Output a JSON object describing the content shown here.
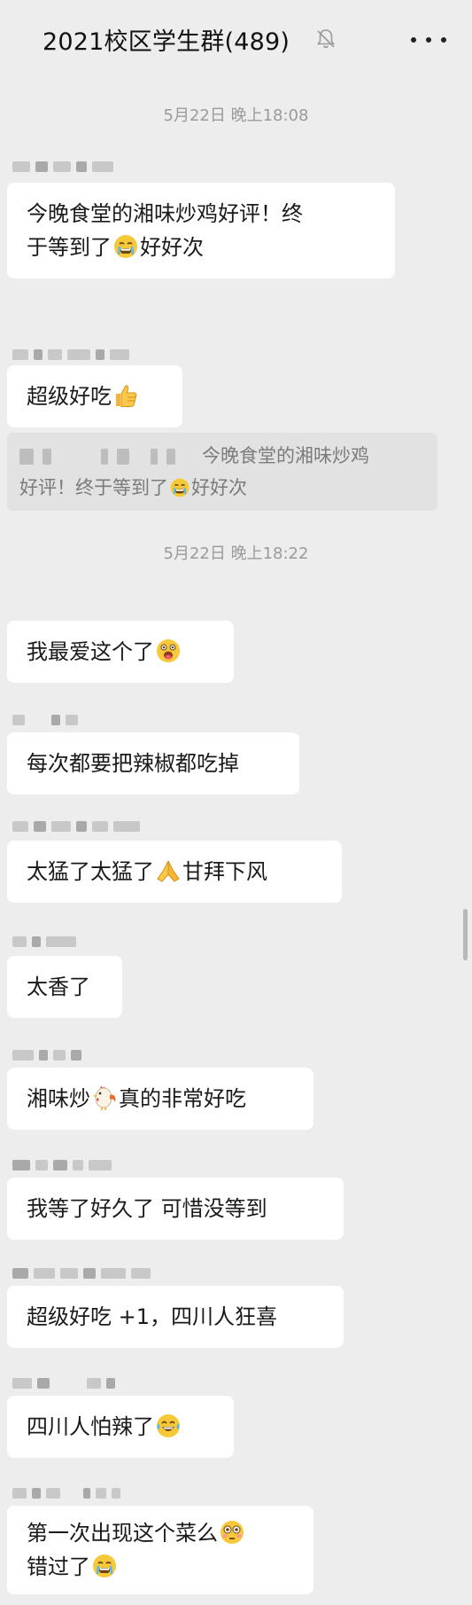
{
  "header": {
    "title": "2021校区学生群(489)",
    "mute_icon": "bell-slash-icon",
    "more_icon": "more-icon"
  },
  "timestamps": [
    "5月22日 晚上18:08",
    "5月22日 晚上18:22"
  ],
  "messages": [
    {
      "line1": "今晚食堂的湘味炒鸡好评！终",
      "line2a": "于等到了",
      "emoji_a": "crying-face-emoji",
      "line2b": "好好次"
    },
    {
      "text": "超级好吃",
      "emoji": "thumbs-up-emoji"
    },
    {
      "text": "我最爱这个了",
      "emoji": "drooling-face-emoji"
    },
    {
      "text": "每次都要把辣椒都吃掉"
    },
    {
      "text_a": "太猛了太猛了",
      "emoji": "praying-hands-emoji",
      "text_b": "甘拜下风"
    },
    {
      "text": "太香了"
    },
    {
      "text_a": "湘味炒",
      "emoji": "rooster-emoji",
      "text_b": "真的非常好吃"
    },
    {
      "text": "我等了好久了 可惜没等到"
    },
    {
      "text": "超级好吃 +1，四川人狂喜"
    },
    {
      "text": "四川人怕辣了",
      "emoji": "tears-of-joy-emoji"
    },
    {
      "line1": "第一次出现这个菜么",
      "emoji_a": "flushed-face-emoji",
      "line2": "错过了",
      "emoji_b": "crying-face-emoji"
    }
  ],
  "quote": {
    "line1": "今晚食堂的湘味炒鸡",
    "line2a": "好评！终于等到了",
    "emoji": "crying-face-emoji",
    "line2b": "好好次"
  },
  "colors": {
    "background": "#ededed",
    "bubble": "#ffffff",
    "quote": "#e2e2e2",
    "timestamp": "#9a9a9a"
  }
}
